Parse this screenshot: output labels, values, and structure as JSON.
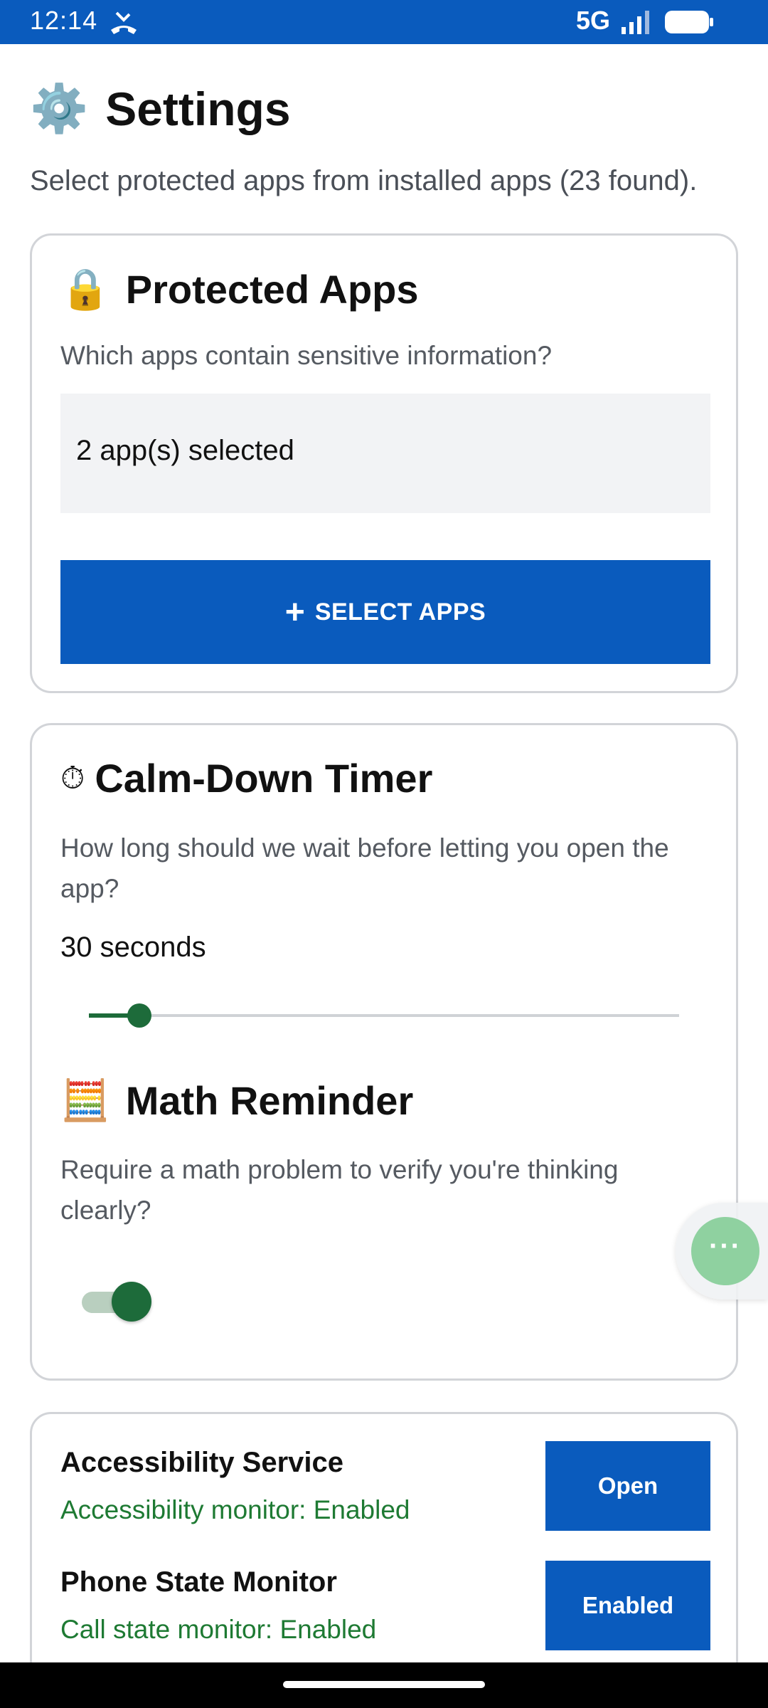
{
  "status_bar": {
    "time": "12:14",
    "network": "5G",
    "icons": [
      "missed-call-icon",
      "signal-icon",
      "battery-icon"
    ]
  },
  "header": {
    "emoji": "⚙️",
    "title": "Settings",
    "subtitle": "Select protected apps from installed apps (23 found)."
  },
  "protected_apps": {
    "emoji": "🔒",
    "title": "Protected Apps",
    "description": "Which apps contain sensitive information?",
    "selection_summary": "2 app(s) selected",
    "button_icon": "+",
    "button_label": "SELECT APPS"
  },
  "timer": {
    "emoji": "⏱",
    "title": "Calm-Down Timer",
    "description": "How long should we wait before letting you open the app?",
    "value_text": "30 seconds",
    "slider_fraction": 0.085
  },
  "math": {
    "emoji": "🧮",
    "title": "Math Reminder",
    "description": "Require a math problem to verify you're thinking clearly?",
    "toggle_on": true
  },
  "services": [
    {
      "title": "Accessibility Service",
      "status": "Accessibility monitor: Enabled",
      "button_label": "Open"
    },
    {
      "title": "Phone State Monitor",
      "status": "Call state monitor: Enabled",
      "button_label": "Enabled"
    }
  ],
  "fab": {
    "icon": "more-icon",
    "dots": "···"
  },
  "colors": {
    "primary": "#0a5bbd",
    "accent_green": "#1d6b3a",
    "status_green": "#1e7a33",
    "fab_green": "#8fd1a0"
  }
}
